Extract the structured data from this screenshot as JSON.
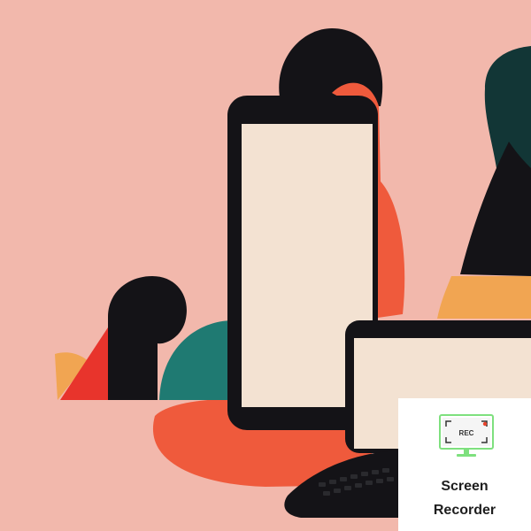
{
  "illustration": {
    "colors": {
      "background": "#f2b8ac",
      "dark": "#141317",
      "screen": "#f3e2d2",
      "orange_red": "#ef5a3c",
      "teal": "#1f7a72",
      "dark_teal": "#123636",
      "amber": "#f1a552",
      "red": "#e8342c"
    }
  },
  "recorder_widget": {
    "icon": "rec-monitor-icon",
    "icon_text": "REC",
    "label_line1": "Screen",
    "label_line2": "Recorder",
    "accent_color": "#7ee07e",
    "dot_color": "#e8432c"
  }
}
